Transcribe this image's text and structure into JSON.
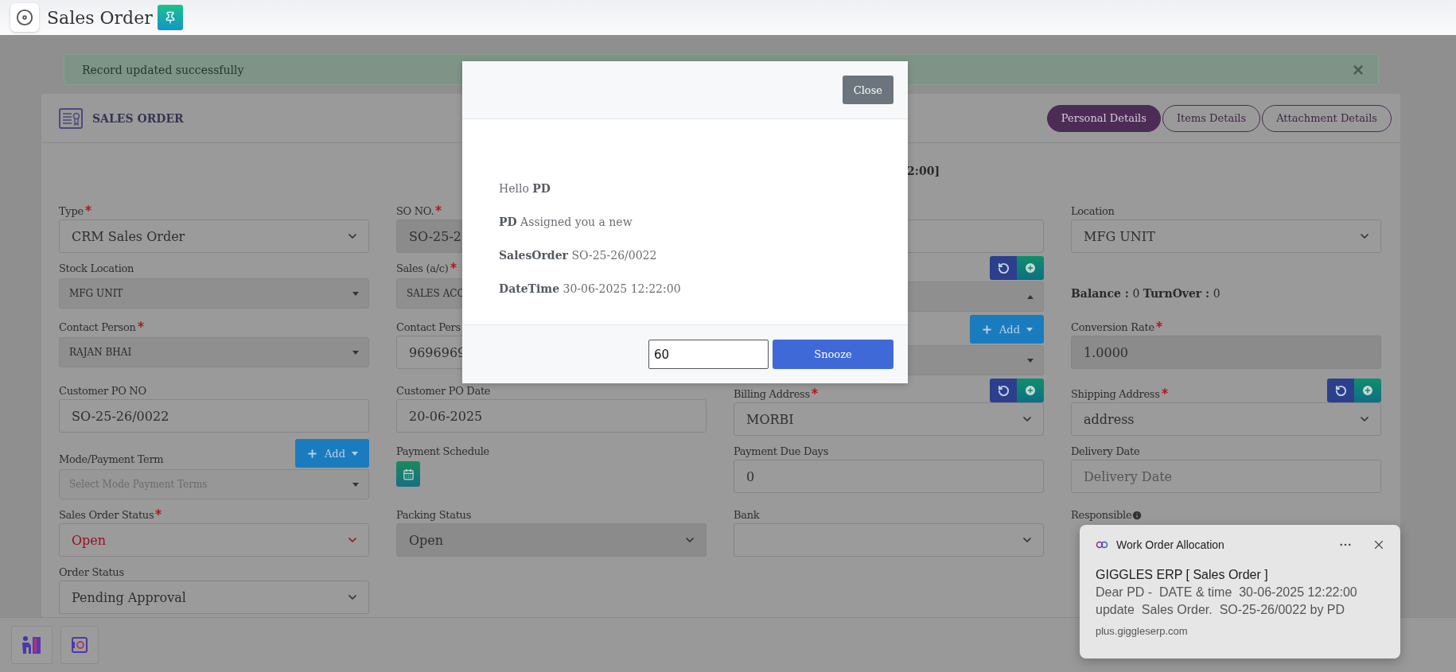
{
  "header": {
    "title": "Sales Order"
  },
  "alert": {
    "message": "Record updated successfully",
    "close": "×"
  },
  "card": {
    "title": "SALES ORDER",
    "tabs": [
      {
        "label": "Personal Details",
        "selected": true
      },
      {
        "label": "Items Details",
        "selected": false
      },
      {
        "label": "Attachment Details",
        "selected": false
      }
    ]
  },
  "heading_fragment": "2:00]",
  "rows": [
    [
      {
        "label": "Type",
        "required": true,
        "kind": "select",
        "value": "CRM Sales Order",
        "disabled": false
      },
      {
        "label": "SO NO.",
        "required": true,
        "kind": "readonly",
        "value": "SO-25-2"
      },
      {
        "kind": "input"
      },
      {
        "label": "Location",
        "required": false,
        "kind": "select",
        "value": "MFG UNIT",
        "disabled": false
      }
    ],
    [
      {
        "label": "Stock Location",
        "required": false,
        "kind": "select2",
        "value": "MFG UNIT",
        "expanded": false,
        "disabled": false
      },
      {
        "label": "Sales (a/c)",
        "required": true,
        "kind": "select2",
        "value": "SALES ACC",
        "disabled": false
      },
      {
        "kind": "select2",
        "expanded": true,
        "actions": [
          {
            "kind": "refresh"
          },
          {
            "kind": "add"
          }
        ]
      },
      {
        "kind": "text",
        "text": "**Balance :** 0 **TurnOver :** 0"
      }
    ],
    [
      {
        "label": "Contact Person",
        "required": true,
        "kind": "select2",
        "value": "RAJAN BHAI",
        "expanded": false,
        "disabled": false
      },
      {
        "label": "Contact Pers",
        "required": false,
        "kind": "input",
        "value": "9696969"
      },
      {
        "kind": "select2",
        "expanded": false,
        "actions": [
          {
            "kind": "add_menu",
            "label": "Add"
          }
        ]
      },
      {
        "label": "Conversion Rate",
        "required": true,
        "kind": "readonly",
        "value": "1.0000"
      }
    ],
    [
      {
        "label": "Customer PO NO",
        "required": false,
        "kind": "input",
        "value": "SO-25-26/0022"
      },
      {
        "label": "Customer PO Date",
        "required": false,
        "kind": "input",
        "value": "20-06-2025"
      },
      {
        "label": "Billing Address",
        "required": true,
        "kind": "select",
        "value": "MORBI",
        "disabled": false,
        "actions": [
          {
            "kind": "refresh"
          },
          {
            "kind": "add"
          }
        ]
      },
      {
        "label": "Shipping Address",
        "required": true,
        "kind": "select",
        "value": "address",
        "disabled": false,
        "actions": [
          {
            "kind": "refresh"
          },
          {
            "kind": "add"
          }
        ]
      }
    ],
    [
      {
        "label": "Mode/Payment Term",
        "required": false,
        "kind": "select2",
        "placeholder": "Select Mode Payment Terms",
        "expanded": false,
        "disabled": true,
        "actions": [
          {
            "kind": "add_menu",
            "label": "Add"
          }
        ]
      },
      {
        "label": "Payment Schedule",
        "required": false,
        "kind": "calendar"
      },
      {
        "label": "Payment Due Days",
        "required": false,
        "kind": "input",
        "value": "0"
      },
      {
        "label": "Delivery Date",
        "required": false,
        "kind": "input",
        "placeholder": "Delivery Date"
      }
    ],
    [
      {
        "label": "Sales Order Status",
        "required": true,
        "kind": "select",
        "value": "Open",
        "error": true,
        "disabled": false
      },
      {
        "label": "Packing Status",
        "required": false,
        "kind": "select",
        "value": "Open",
        "disabled": true
      },
      {
        "label": "Bank",
        "required": false,
        "kind": "select",
        "disabled": false
      },
      {
        "label": "Responsible",
        "required": false,
        "kind": "label",
        "info": true
      }
    ],
    [
      {
        "label": "Order Status",
        "required": false,
        "kind": "select",
        "value": "Pending Approval",
        "disabled": false
      }
    ]
  ],
  "modal": {
    "close": "Close",
    "lines": [
      "Hello **PD**",
      "**PD** Assigned you a new",
      "**SalesOrder** SO-25-26/0022",
      "**DateTime** 30-06-2025 12:22:00"
    ],
    "snooze_value": "60",
    "snooze": "Snooze"
  },
  "notification": {
    "app": "Work Order Allocation",
    "title": "GIGGLES ERP [ Sales Order ]",
    "lines": [
      "Dear PD -  DATE & time  30-06-2025 12:22:00",
      "update  Sales Order.  SO-25-26/0022 by PD"
    ],
    "source": "plus.giggleserp.com"
  }
}
